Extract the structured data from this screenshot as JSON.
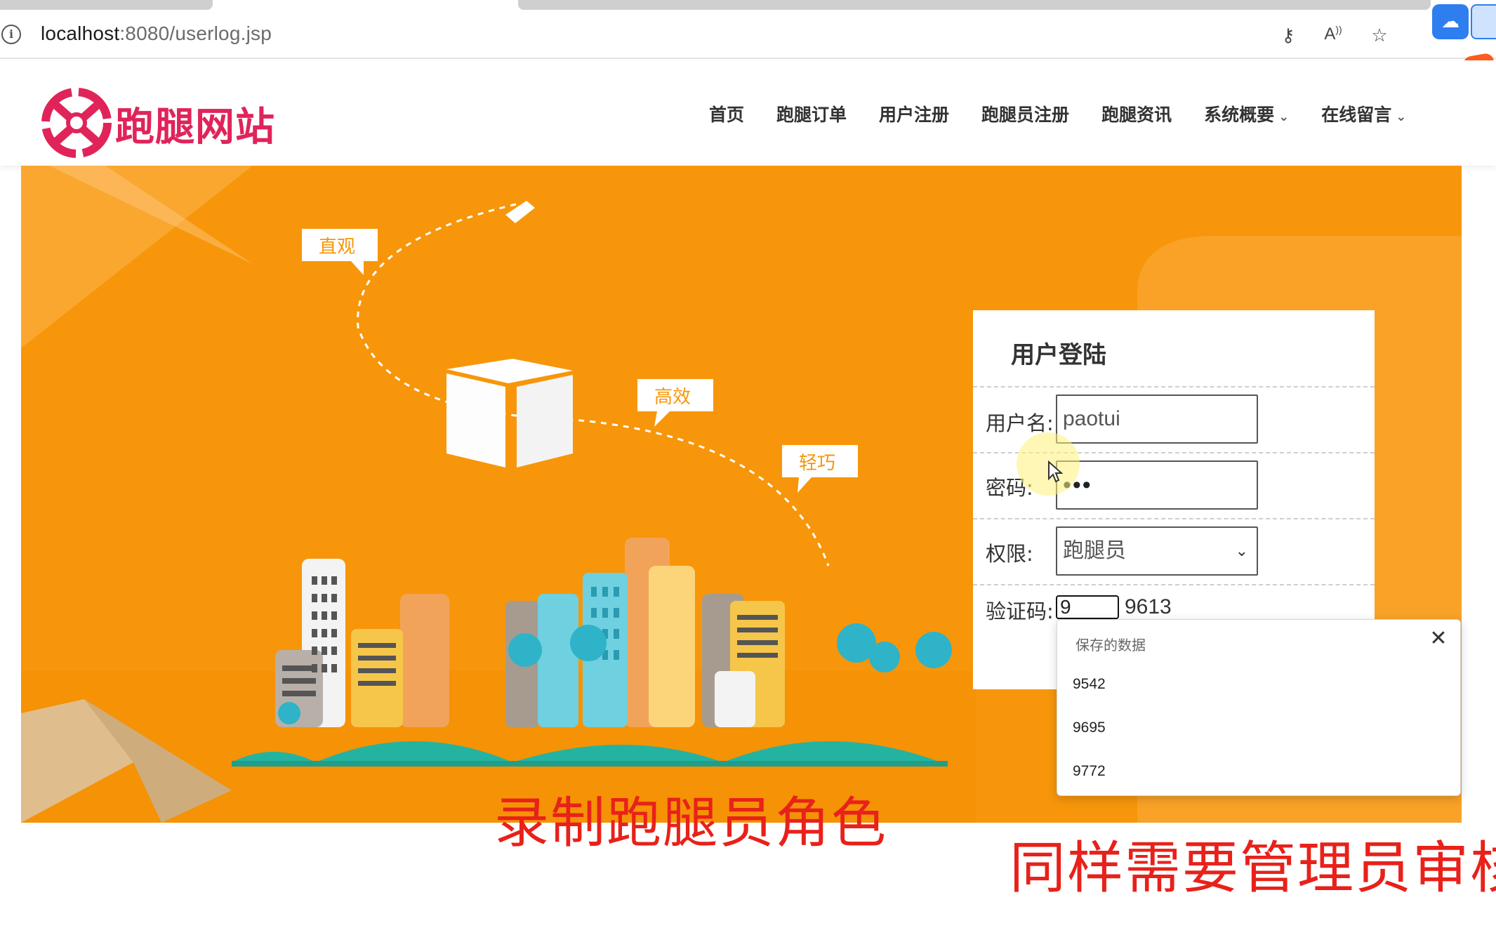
{
  "browser": {
    "url_host": "localhost",
    "url_rest": ":8080/userlog.jsp",
    "icons": [
      "info-icon",
      "key-icon",
      "read-aloud-icon",
      "favorites-add-icon"
    ]
  },
  "site": {
    "logo_text": "跑腿网站",
    "nav": [
      {
        "label": "首页"
      },
      {
        "label": "跑腿订单"
      },
      {
        "label": "用户注册"
      },
      {
        "label": "跑腿员注册"
      },
      {
        "label": "跑腿资讯"
      },
      {
        "label": "系统概要",
        "dropdown": true
      },
      {
        "label": "在线留言",
        "dropdown": true
      }
    ]
  },
  "banner": {
    "tags": [
      "直观",
      "高效",
      "轻巧"
    ]
  },
  "login": {
    "title": "用户登陆",
    "username_label": "用户名:",
    "username_value": "paotui",
    "password_label": "密码:",
    "password_value": "•••",
    "role_label": "权限:",
    "role_value": "跑腿员",
    "captcha_label": "验证码:",
    "captcha_input": "9",
    "captcha_code": "9613"
  },
  "autofill": {
    "title": "保存的数据",
    "items": [
      "9542",
      "9695",
      "9772"
    ]
  },
  "captions": {
    "line1": "录制跑腿员角色",
    "line2": "同样需要管理员审核"
  },
  "colors": {
    "banner": "#f7960a",
    "brand": "#e0245a",
    "caption": "#e8211a"
  }
}
